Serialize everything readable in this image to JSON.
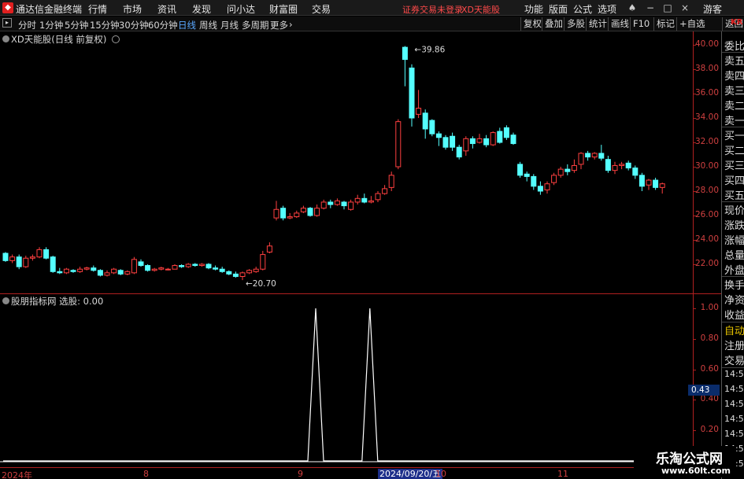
{
  "app": {
    "title": "通达信金融终端",
    "menu": [
      "行情",
      "市场",
      "资讯",
      "发现",
      "问小达",
      "财富圈",
      "交易"
    ],
    "trade_warning": "证券交易未登录",
    "stock_name": "XD天能股",
    "right_menu": [
      "功能",
      "版面",
      "公式",
      "选项"
    ],
    "user": "游客"
  },
  "toolbar": {
    "periods": [
      "分时",
      "1分钟",
      "5分钟",
      "15分钟",
      "30分钟",
      "60分钟",
      "日线",
      "周线",
      "月线",
      "多周期",
      "更多"
    ],
    "active_period": "日线",
    "buttons": [
      "复权",
      "叠加",
      "多股",
      "统计",
      "画线",
      "F10",
      "标记",
      "+自选",
      "返回"
    ]
  },
  "chart": {
    "title": "XD天能股(日线 前复权)",
    "indicator_title": "股朋指标网 选股: 0.00",
    "high_label": "39.86",
    "low_label": "20.70",
    "current_indicator_value": "0.43",
    "cursor_date": "2024/09/20/五",
    "x_ticks": [
      "2024年",
      "8",
      "9",
      "10",
      "11"
    ],
    "price_ticks": [
      "40.00",
      "38.00",
      "36.00",
      "34.00",
      "32.00",
      "30.00",
      "28.00",
      "26.00",
      "24.00",
      "22.00"
    ],
    "ind_ticks": [
      "1.00",
      "0.80",
      "0.60",
      "0.40",
      "0.20"
    ]
  },
  "chart_data": {
    "type": "candlestick",
    "title": "XD天能股(日线 前复权)",
    "ylim": [
      20,
      40.5
    ],
    "colors": {
      "up": "#ff4040",
      "down": "#54ffff",
      "indicator": "#ffffff"
    },
    "candles": [
      [
        22.9,
        22.3,
        23.0,
        22.2
      ],
      [
        22.3,
        22.6,
        22.8,
        22.1
      ],
      [
        22.6,
        21.8,
        22.8,
        21.6
      ],
      [
        21.8,
        22.5,
        22.7,
        21.7
      ],
      [
        22.5,
        22.6,
        22.8,
        22.3
      ],
      [
        22.6,
        23.2,
        23.4,
        22.5
      ],
      [
        23.2,
        22.5,
        23.4,
        22.4
      ],
      [
        22.6,
        21.4,
        22.7,
        21.3
      ],
      [
        21.4,
        21.3,
        21.7,
        21.2
      ],
      [
        21.3,
        21.6,
        21.7,
        21.2
      ],
      [
        21.5,
        21.4,
        21.6,
        21.3
      ],
      [
        21.4,
        21.6,
        21.8,
        21.3
      ],
      [
        21.6,
        21.7,
        21.8,
        21.5
      ],
      [
        21.7,
        21.5,
        21.9,
        21.4
      ],
      [
        21.5,
        21.1,
        21.6,
        21.0
      ],
      [
        21.1,
        21.3,
        21.5,
        21.0
      ],
      [
        21.3,
        21.6,
        21.7,
        21.2
      ],
      [
        21.5,
        21.2,
        21.6,
        21.1
      ],
      [
        21.2,
        21.4,
        21.5,
        21.1
      ],
      [
        21.3,
        22.4,
        22.6,
        21.2
      ],
      [
        22.2,
        21.9,
        22.4,
        21.8
      ],
      [
        21.9,
        21.5,
        22.0,
        21.4
      ],
      [
        21.5,
        21.6,
        21.7,
        21.4
      ],
      [
        21.6,
        21.7,
        21.8,
        21.5
      ],
      [
        21.6,
        21.6,
        21.7,
        21.5
      ],
      [
        21.6,
        21.9,
        22.0,
        21.6
      ],
      [
        21.9,
        21.8,
        22.0,
        21.7
      ],
      [
        21.8,
        22.0,
        22.1,
        21.7
      ],
      [
        22.0,
        21.9,
        22.1,
        21.8
      ],
      [
        21.9,
        22.0,
        22.1,
        21.8
      ],
      [
        22.0,
        21.7,
        22.1,
        21.6
      ],
      [
        21.7,
        21.6,
        21.9,
        21.5
      ],
      [
        21.6,
        21.4,
        21.8,
        21.3
      ],
      [
        21.4,
        21.2,
        21.5,
        21.1
      ],
      [
        21.2,
        21.0,
        21.4,
        20.9
      ],
      [
        21.0,
        21.3,
        21.4,
        20.7
      ],
      [
        21.3,
        21.5,
        21.6,
        21.2
      ],
      [
        21.4,
        21.6,
        21.8,
        21.3
      ],
      [
        21.6,
        22.8,
        23.1,
        21.5
      ],
      [
        23.0,
        23.5,
        23.8,
        22.9
      ],
      [
        25.8,
        26.5,
        27.2,
        25.6
      ],
      [
        26.6,
        25.8,
        26.8,
        25.6
      ],
      [
        25.8,
        25.9,
        26.2,
        25.7
      ],
      [
        25.9,
        26.2,
        26.4,
        25.8
      ],
      [
        26.3,
        26.6,
        26.8,
        26.2
      ],
      [
        26.6,
        26.0,
        26.7,
        25.9
      ],
      [
        26.0,
        26.6,
        26.9,
        25.9
      ],
      [
        26.6,
        27.1,
        27.3,
        26.5
      ],
      [
        27.1,
        26.9,
        27.3,
        26.6
      ],
      [
        26.9,
        27.2,
        27.4,
        26.8
      ],
      [
        27.1,
        26.8,
        27.2,
        26.5
      ],
      [
        26.5,
        27.1,
        27.3,
        26.4
      ],
      [
        27.1,
        27.4,
        27.7,
        26.9
      ],
      [
        27.4,
        27.1,
        27.8,
        27.0
      ],
      [
        27.1,
        27.2,
        27.6,
        27.0
      ],
      [
        27.3,
        27.8,
        28.0,
        27.1
      ],
      [
        27.8,
        28.2,
        28.5,
        27.7
      ],
      [
        28.3,
        29.3,
        29.6,
        28.0
      ],
      [
        30.0,
        33.7,
        33.9,
        29.8
      ],
      [
        39.8,
        38.8,
        39.9,
        36.6
      ],
      [
        38.1,
        34.0,
        38.4,
        33.3
      ],
      [
        34.3,
        34.8,
        36.3,
        34.0
      ],
      [
        34.4,
        33.1,
        34.7,
        32.3
      ],
      [
        33.8,
        32.7,
        33.9,
        32.5
      ],
      [
        32.7,
        32.4,
        32.9,
        31.7
      ],
      [
        32.4,
        31.6,
        32.6,
        31.4
      ],
      [
        32.5,
        31.6,
        32.8,
        31.3
      ],
      [
        31.6,
        30.8,
        31.8,
        30.6
      ],
      [
        31.3,
        32.3,
        32.5,
        30.9
      ],
      [
        32.3,
        31.9,
        32.5,
        31.5
      ],
      [
        32.0,
        32.3,
        32.7,
        31.9
      ],
      [
        32.3,
        31.8,
        32.6,
        31.6
      ],
      [
        31.8,
        32.8,
        32.9,
        31.7
      ],
      [
        32.9,
        32.0,
        33.2,
        31.9
      ],
      [
        33.2,
        32.4,
        33.4,
        32.2
      ],
      [
        32.6,
        31.9,
        32.8,
        31.8
      ],
      [
        30.2,
        29.3,
        30.4,
        29.1
      ],
      [
        29.4,
        29.2,
        29.6,
        28.8
      ],
      [
        29.2,
        28.4,
        29.4,
        28.1
      ],
      [
        28.4,
        28.0,
        28.8,
        27.7
      ],
      [
        28.1,
        28.6,
        28.8,
        27.8
      ],
      [
        28.7,
        29.3,
        29.5,
        28.5
      ],
      [
        29.3,
        29.8,
        30.0,
        29.1
      ],
      [
        29.8,
        29.6,
        30.2,
        29.3
      ],
      [
        29.7,
        30.1,
        30.6,
        29.5
      ],
      [
        30.2,
        31.1,
        31.2,
        29.8
      ],
      [
        31.1,
        30.8,
        31.3,
        30.5
      ],
      [
        30.8,
        31.1,
        31.2,
        30.6
      ],
      [
        31.1,
        30.7,
        31.8,
        30.5
      ],
      [
        30.6,
        29.7,
        30.9,
        29.5
      ],
      [
        29.7,
        30.1,
        30.4,
        29.4
      ],
      [
        30.1,
        30.2,
        30.4,
        29.8
      ],
      [
        30.3,
        29.9,
        30.5,
        29.7
      ],
      [
        29.9,
        29.3,
        30.1,
        29.0
      ],
      [
        29.3,
        28.4,
        29.5,
        28.0
      ],
      [
        28.5,
        28.9,
        29.0,
        28.1
      ],
      [
        28.9,
        28.3,
        29.1,
        28.1
      ],
      [
        28.3,
        28.6,
        28.7,
        27.8
      ]
    ],
    "indicator": {
      "name": "选股",
      "ylim": [
        0,
        1.1
      ],
      "signal_indices": [
        40,
        48
      ]
    }
  }
}
